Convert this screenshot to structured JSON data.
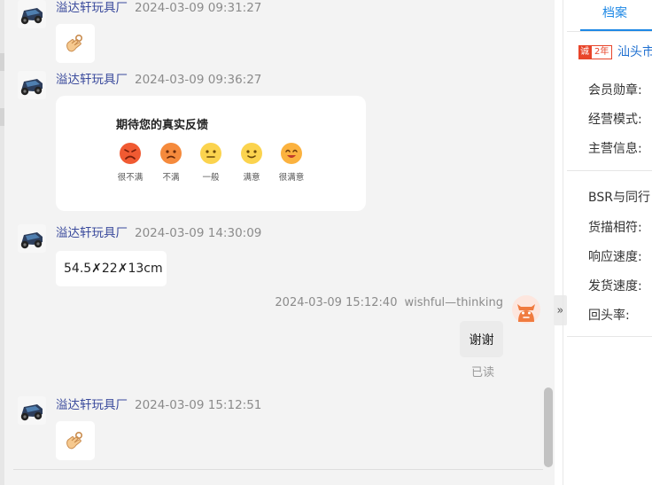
{
  "chat": {
    "messages": [
      {
        "sender": "溢达轩玩具厂",
        "time": "2024-03-09 09:31:27",
        "content_type": "emoji",
        "emoji": "ok-hand-icon"
      },
      {
        "sender": "溢达轩玩具厂",
        "time": "2024-03-09 09:36:27",
        "content_type": "feedback-card"
      },
      {
        "sender": "溢达轩玩具厂",
        "time": "2024-03-09 14:30:09",
        "content_type": "text",
        "text": "54.5✗22✗13cm"
      },
      {
        "sender": "溢达轩玩具厂",
        "time": "2024-03-09 15:12:51",
        "content_type": "emoji",
        "emoji": "ok-hand-icon"
      }
    ],
    "feedback_card": {
      "title": "期待您的真实反馈",
      "options": [
        {
          "label": "很不满",
          "color": "#f05a32"
        },
        {
          "label": "不满",
          "color": "#f58a3c"
        },
        {
          "label": "一般",
          "color": "#fbd34e"
        },
        {
          "label": "满意",
          "color": "#fbd34e"
        },
        {
          "label": "很满意",
          "color": "#fbb23f"
        }
      ]
    },
    "my_message": {
      "time": "2024-03-09 15:12:40",
      "name": "wishful—thinking",
      "text": "谢谢",
      "status": "已读"
    },
    "collapse_icon": "»"
  },
  "panel": {
    "tab_label": "档案",
    "cheng_badge": "诚",
    "years_badge": "2年",
    "company_short": "汕头市",
    "fields_group1": [
      "会员勋章:",
      "经营模式:",
      "主营信息:"
    ],
    "fields_group2": [
      "BSR与同行",
      "货描相符:",
      "响应速度:",
      "发货速度:",
      "回头率:"
    ],
    "accent_color": "#1e88e5",
    "badge_color": "#e8452a"
  }
}
